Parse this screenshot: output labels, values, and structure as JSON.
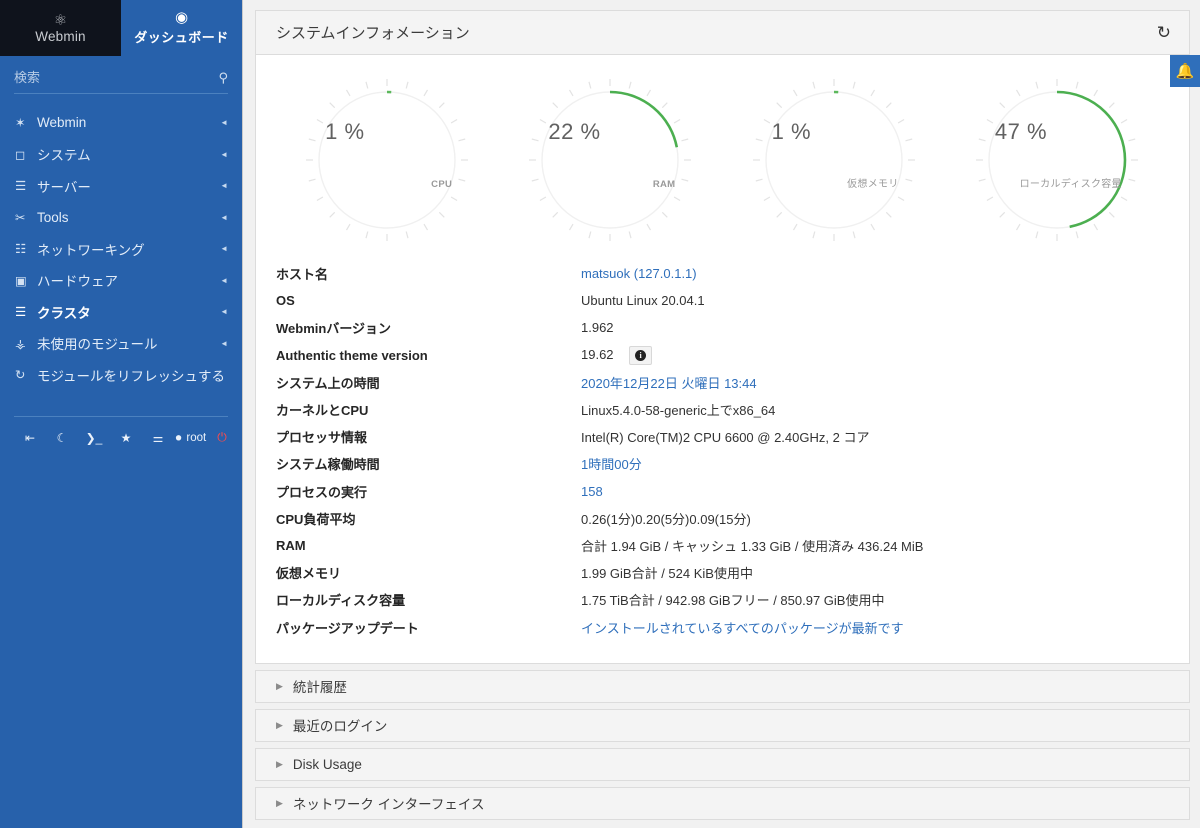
{
  "sidebar": {
    "brand": {
      "icon": "webmin-logo-icon",
      "label": "Webmin"
    },
    "dashboard": {
      "icon": "dashboard-icon",
      "label": "ダッシュボード"
    },
    "search": {
      "placeholder": "検索",
      "value": "",
      "icon": "search-icon"
    },
    "nav": [
      {
        "icon": "gear-icon",
        "label": "Webmin",
        "caret": "◄",
        "active": false
      },
      {
        "icon": "monitor-icon",
        "label": "システム",
        "caret": "◄",
        "active": false
      },
      {
        "icon": "server-icon",
        "label": "サーバー",
        "caret": "◄",
        "active": false
      },
      {
        "icon": "tools-icon",
        "label": "Tools",
        "caret": "◄",
        "active": false
      },
      {
        "icon": "network-icon",
        "label": "ネットワーキング",
        "caret": "◄",
        "active": false
      },
      {
        "icon": "hardware-icon",
        "label": "ハードウェア",
        "caret": "◄",
        "active": false
      },
      {
        "icon": "cluster-icon",
        "label": "クラスタ",
        "caret": "◄",
        "active": true
      },
      {
        "icon": "unused-icon",
        "label": "未使用のモジュール",
        "caret": "◄",
        "active": false
      },
      {
        "icon": "refresh-icon",
        "label": "モジュールをリフレッシュする",
        "caret": "",
        "active": false
      }
    ],
    "tools": [
      {
        "name": "collapse-sidebar-button",
        "glyph": "⇤",
        "label": ""
      },
      {
        "name": "night-mode-button",
        "glyph": "☾",
        "label": ""
      },
      {
        "name": "terminal-button",
        "glyph": "❯_",
        "label": ""
      },
      {
        "name": "favorites-button",
        "glyph": "★",
        "label": ""
      },
      {
        "name": "settings-sliders-button",
        "glyph": "⚌",
        "label": ""
      },
      {
        "name": "user-button",
        "glyph": "👤",
        "label": "root"
      },
      {
        "name": "logout-button",
        "glyph": "⏻",
        "label": ""
      }
    ]
  },
  "panel": {
    "title": "システムインフォメーション",
    "refresh_icon": "refresh-icon",
    "bell_icon": "bell-icon"
  },
  "chart_data": {
    "type": "gauge",
    "title": "システムインフォメーション",
    "gauges": [
      {
        "label": "CPU",
        "value": 1,
        "display": "1 %",
        "max": 100,
        "color": "#5cb85c"
      },
      {
        "label": "RAM",
        "value": 22,
        "display": "22 %",
        "max": 100,
        "color": "#4caf50"
      },
      {
        "label": "仮想メモリ",
        "value": 1,
        "display": "1 %",
        "max": 100,
        "color": "#5cb85c"
      },
      {
        "label": "ローカルディスク容量",
        "value": 47,
        "display": "47 %",
        "max": 100,
        "color": "#4caf50"
      }
    ]
  },
  "info": {
    "rows": [
      {
        "key": "ホスト名",
        "value": "matsuok (127.0.1.1)",
        "link": true
      },
      {
        "key": "OS",
        "value": "Ubuntu Linux 20.04.1",
        "link": false
      },
      {
        "key": "Webminバージョン",
        "value": "1.962",
        "link": false
      },
      {
        "key": "Authentic theme version",
        "value": "19.62",
        "link": false,
        "badge": "info-icon"
      },
      {
        "key": "システム上の時間",
        "value": "2020年12月22日 火曜日 13:44",
        "link": true
      },
      {
        "key": "カーネルとCPU",
        "value": "Linux5.4.0-58-generic上でx86_64",
        "link": false
      },
      {
        "key": "プロセッサ情報",
        "value": "Intel(R) Core(TM)2 CPU 6600 @ 2.40GHz, 2 コア",
        "link": false
      },
      {
        "key": "システム稼働時間",
        "value": "1時間00分",
        "link": true
      },
      {
        "key": "プロセスの実行",
        "value": "158",
        "link": true
      },
      {
        "key": "CPU負荷平均",
        "value": "0.26(1分)0.20(5分)0.09(15分)",
        "link": false
      },
      {
        "key": "RAM",
        "value": "合計 1.94 GiB / キャッシュ 1.33 GiB / 使用済み 436.24 MiB",
        "link": false
      },
      {
        "key": "仮想メモリ",
        "value": "1.99 GiB合計 / 524 KiB使用中",
        "link": false
      },
      {
        "key": "ローカルディスク容量",
        "value": "1.75 TiB合計 / 942.98 GiBフリー / 850.97 GiB使用中",
        "link": false
      },
      {
        "key": "パッケージアップデート",
        "value": "インストールされているすべてのパッケージが最新です",
        "link": true
      }
    ]
  },
  "accordions": [
    {
      "label": "統計履歴",
      "caret": "▶"
    },
    {
      "label": "最近のログイン",
      "caret": "▶"
    },
    {
      "label": "Disk Usage",
      "caret": "▶"
    },
    {
      "label": "ネットワーク インターフェイス",
      "caret": "▶"
    }
  ],
  "colors": {
    "sidebar_blue": "#2761ab",
    "brand_dark": "#0f131c",
    "accent_green": "#4caf50",
    "link_blue": "#2f6fbb"
  }
}
